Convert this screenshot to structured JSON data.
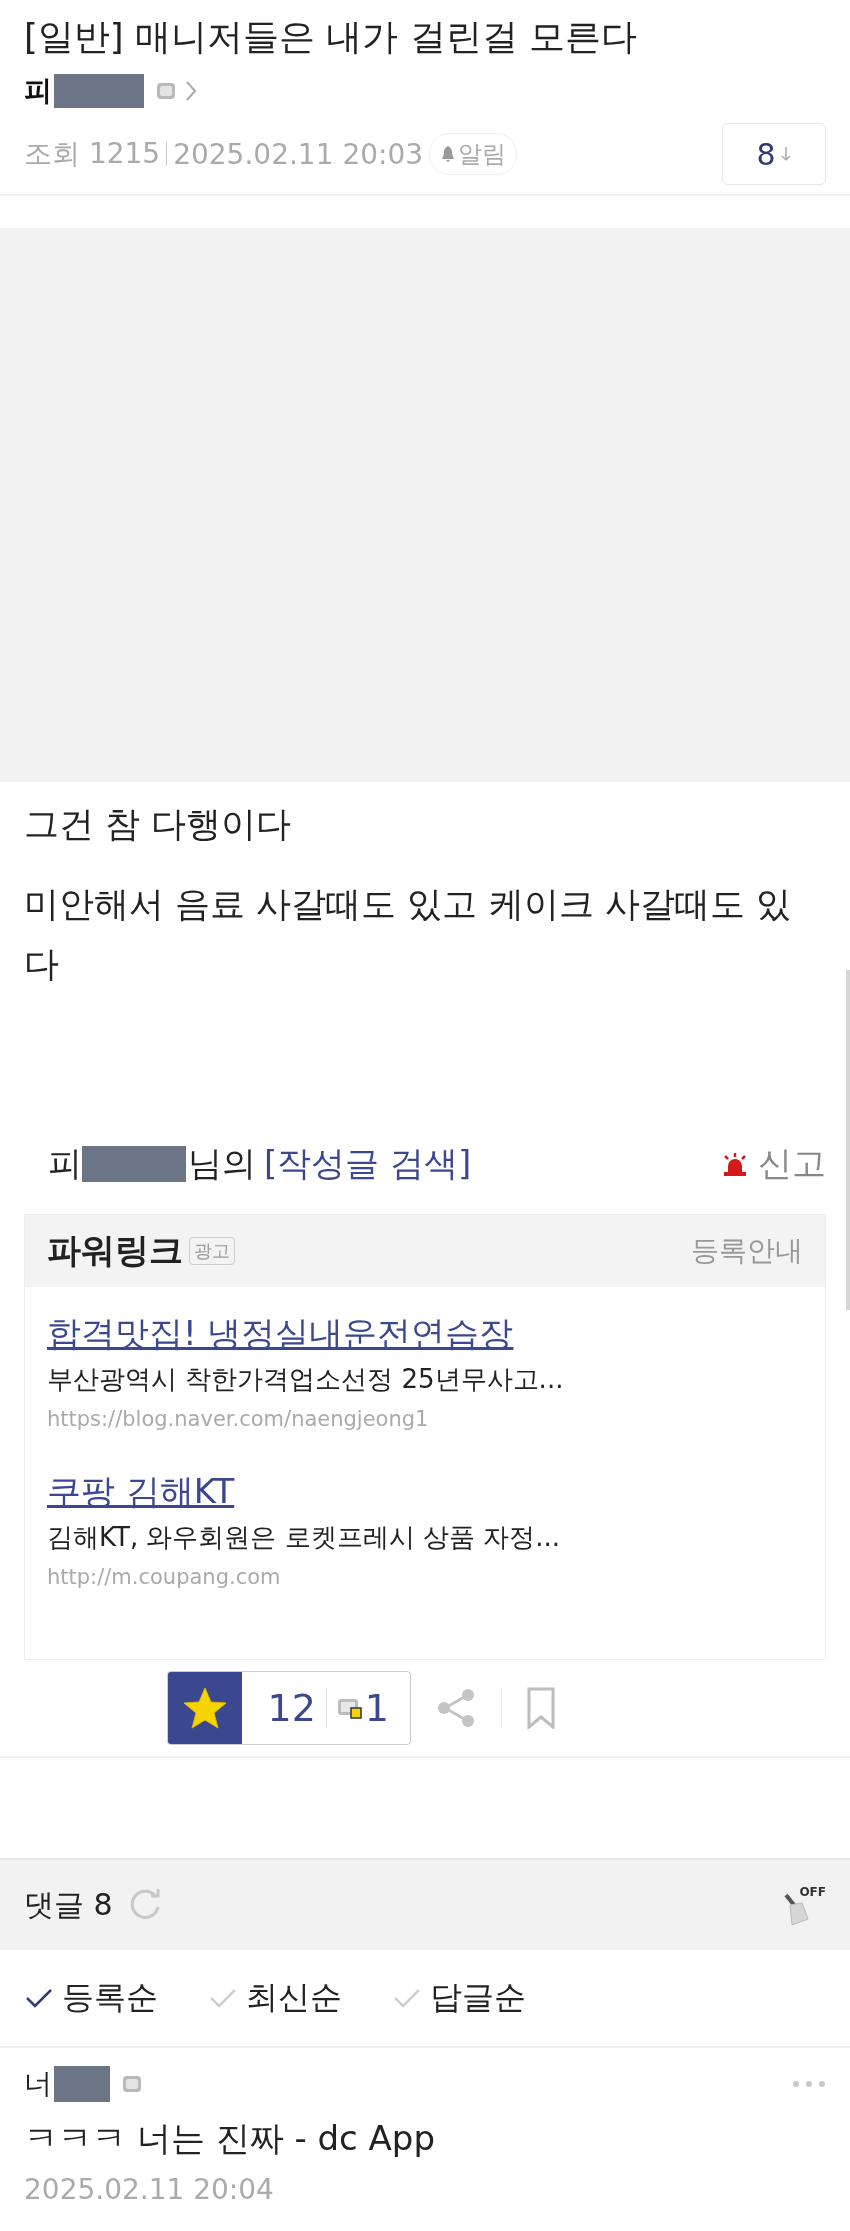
{
  "post": {
    "title": "[일반] 매니저들은 내가 걸린걸 모른다",
    "author": {
      "name": "피",
      "redacted": true
    },
    "views_label": "조회",
    "views": "1215",
    "date": "2025.02.11 20:03",
    "alert_label": "알림",
    "comment_count": "8"
  },
  "image": {
    "kind": "placeholder"
  },
  "body": [
    "그건 참 다행이다",
    "미안해서 음료 사갈때도 있고 케이크 사갈때도 있다"
  ],
  "author_search": {
    "name": "피",
    "redacted": true,
    "suffix": "님의",
    "link": "[작성글 검색]",
    "report": "신고"
  },
  "powerlink": {
    "title": "파워링크",
    "badge": "광고",
    "register": "등록안내",
    "ads": [
      {
        "title": "합격맛집! 냉정실내운전연습장",
        "description": "부산광역시 착한가격업소선정 25년무사고...",
        "url": "https://blog.naver.com/naengjeong1"
      },
      {
        "title": "쿠팡 김해KT",
        "description": "김해KT, 와우회원은 로켓프레시 상품 자정...",
        "url": "http://m.coupang.com"
      }
    ]
  },
  "recommend": {
    "count": "12",
    "fixed_count": "1"
  },
  "comments": {
    "label": "댓글",
    "count": "8",
    "filter_state": "OFF",
    "sort": [
      {
        "label": "등록순",
        "selected": true
      },
      {
        "label": "최신순",
        "selected": false
      },
      {
        "label": "답글순",
        "selected": false
      }
    ],
    "items": [
      {
        "name": "너",
        "redacted": true,
        "text": "ㅋㅋㅋ 너는 진짜 - dc App",
        "date": "2025.02.11 20:04"
      }
    ]
  }
}
